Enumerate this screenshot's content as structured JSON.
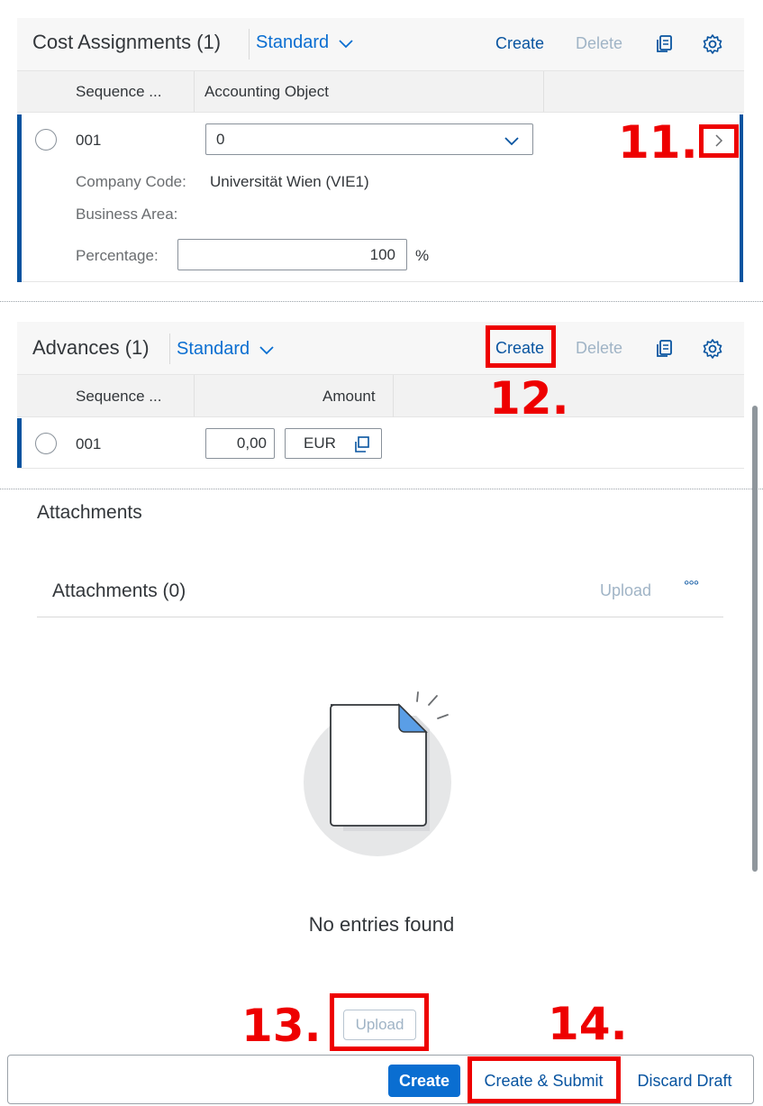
{
  "cost_assignments": {
    "title": "Cost Assignments (1)",
    "variant": "Standard",
    "create": "Create",
    "delete": "Delete",
    "columns": [
      "Sequence ...",
      "Accounting Object"
    ],
    "row": {
      "sequence": "001",
      "accounting_object": "0",
      "company_code_label": "Company Code:",
      "company_code_value": "Universität Wien (VIE1)",
      "business_area_label": "Business Area:",
      "percentage_label": "Percentage:",
      "percentage_value": "100",
      "percentage_unit": "%"
    }
  },
  "advances": {
    "title": "Advances (1)",
    "variant": "Standard",
    "create": "Create",
    "delete": "Delete",
    "columns": [
      "Sequence ...",
      "Amount"
    ],
    "row": {
      "sequence": "001",
      "amount": "0,00",
      "currency": "EUR"
    }
  },
  "attachments": {
    "section_title": "Attachments",
    "toolbar_title": "Attachments (0)",
    "upload": "Upload",
    "more": "°°°",
    "empty_text": "No entries found",
    "upload_button": "Upload"
  },
  "footer": {
    "create": "Create",
    "create_submit": "Create & Submit",
    "discard": "Discard Draft"
  },
  "annotations": {
    "step11": "11.",
    "step12": "12.",
    "step13": "13.",
    "step14": "14."
  },
  "colors": {
    "accent": "#0a6ed1",
    "highlight": "#0854a0",
    "annotation_red": "#ee0000"
  },
  "icons": [
    "chevron-down-icon",
    "copy-icon",
    "settings-icon",
    "navigation-arrow-icon",
    "value-help-icon",
    "more-icon",
    "document-illustration"
  ]
}
